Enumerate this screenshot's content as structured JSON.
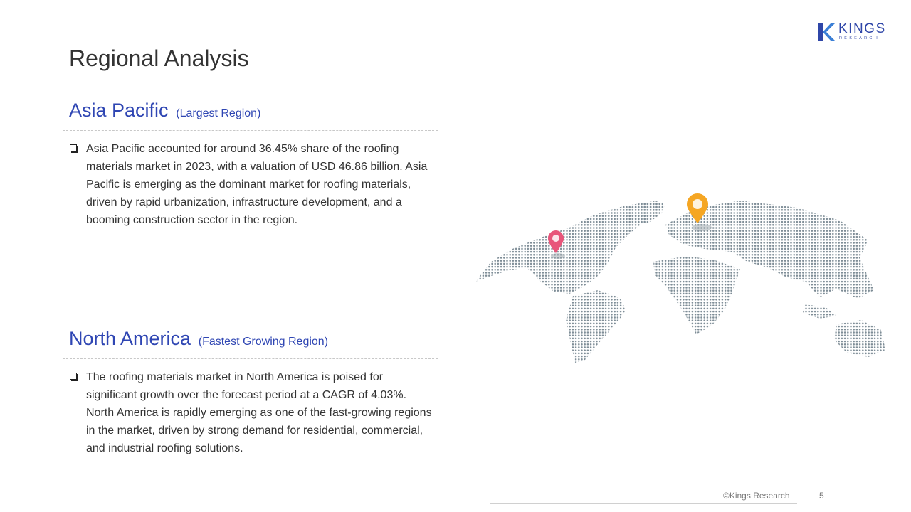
{
  "logo": {
    "word": "KINGS",
    "sub": "RESEARCH"
  },
  "title": "Regional Analysis",
  "sections": [
    {
      "name": "Asia Pacific",
      "note": "(Largest Region)",
      "text": "Asia Pacific accounted for around 36.45% share of the roofing materials market in 2023, with a valuation of USD 46.86 billion. Asia Pacific is emerging as the dominant market for roofing materials, driven by rapid urbanization, infrastructure development, and a booming construction sector in the region."
    },
    {
      "name": "North America",
      "note": "(Fastest Growing Region)",
      "text": "The roofing materials market in North America is poised for significant growth over the forecast period at a CAGR of 4.03%. North America is rapidly emerging as one of the fast-growing regions in the market, driven by strong demand for residential, commercial, and industrial roofing solutions."
    }
  ],
  "map": {
    "dot_color": "#7d8c96",
    "pins": [
      {
        "name": "pin-north-america",
        "color": "#e8557a"
      },
      {
        "name": "pin-asia-pacific",
        "color": "#f5a623"
      }
    ]
  },
  "footer": {
    "copyright": "©Kings Research",
    "page": "5"
  }
}
